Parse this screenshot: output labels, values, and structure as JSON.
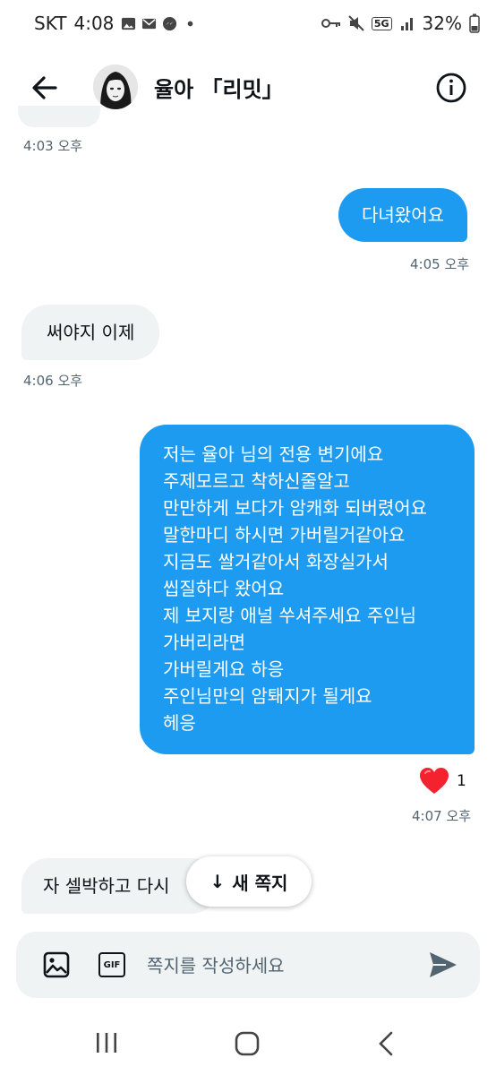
{
  "status_bar": {
    "carrier": "SKT",
    "time": "4:08",
    "network": "5G",
    "battery": "32%"
  },
  "header": {
    "title": "율아 「리밋」"
  },
  "messages": [
    {
      "side": "in",
      "text": "",
      "time": "4:03 오후"
    },
    {
      "side": "out",
      "text": "다녀왔어요",
      "time": "4:05 오후"
    },
    {
      "side": "in",
      "text": "써야지 이제",
      "time": "4:06 오후"
    },
    {
      "side": "out",
      "lines": [
        "저는 율아 님의 전용 변기에요",
        "주제모르고 착하신줄알고",
        "만만하게 보다가 암캐화 되버렸어요",
        "말한마디 하시면 가버릴거같아요",
        "지금도 쌀거같아서 화장실가서",
        "씹질하다 왔어요",
        "제 보지랑 애널 쑤셔주세요 주인님",
        "가버리라면",
        "가버릴게요 하응",
        "주인님만의 암퇘지가 될게요",
        "헤응"
      ],
      "reaction_count": "1",
      "time": "4:07 오후"
    },
    {
      "side": "in",
      "text": "자 셀박하고 다시"
    }
  ],
  "new_message_pill": {
    "label": "새 쪽지",
    "arrow": "↓"
  },
  "composer": {
    "placeholder": "쪽지를 작성하세요",
    "gif_label": "GIF"
  },
  "icons": {
    "back": "arrow-left-icon",
    "info": "info-icon",
    "image": "image-icon",
    "gif": "gif-icon",
    "send": "send-icon",
    "reaction": "heart-icon"
  },
  "colors": {
    "outgoing_bubble": "#1d9bf0",
    "incoming_bubble": "#eff3f4",
    "timestamp": "#536471",
    "heart": "#f4212e"
  }
}
